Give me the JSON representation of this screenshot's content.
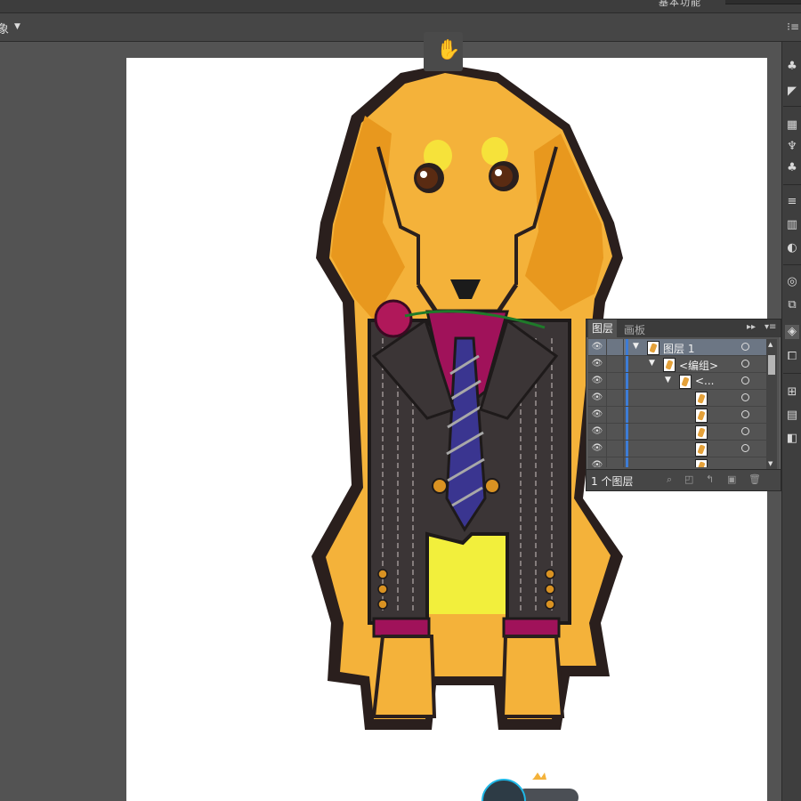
{
  "app": {
    "workspace_label": "基本功能",
    "control_bar_label": "象"
  },
  "colors": {
    "ui_dark": "#535353",
    "artboard": "#ffffff",
    "selection_bar": "#3d7cd6",
    "dog_fur": "#f4b23a",
    "suit": "#3b3536",
    "shirt": "#a0125a",
    "tie_stripe": "#3a3590"
  },
  "layers_panel": {
    "tabs": [
      "图层",
      "画板"
    ],
    "menu_icon": "panel-menu-icon",
    "rows": [
      {
        "name": "图层 1",
        "indent": 0,
        "expanded": true,
        "selected": true
      },
      {
        "name": "<编组>",
        "indent": 1,
        "expanded": true,
        "selected": false
      },
      {
        "name": "<...",
        "indent": 2,
        "expanded": true,
        "selected": false
      },
      {
        "name": "",
        "indent": 3,
        "expanded": false,
        "selected": false
      },
      {
        "name": "",
        "indent": 3,
        "expanded": false,
        "selected": false
      },
      {
        "name": "",
        "indent": 3,
        "expanded": false,
        "selected": false
      },
      {
        "name": "",
        "indent": 3,
        "expanded": false,
        "selected": false
      },
      {
        "name": "",
        "indent": 3,
        "expanded": false,
        "selected": false
      }
    ],
    "footer_count": "1 个图层"
  },
  "right_dock_icons": [
    "color-icon",
    "gradient-icon",
    "swatches-icon",
    "brushes-icon",
    "symbols-icon",
    "stroke-icon",
    "transparency-icon",
    "appearance-icon",
    "graphic-styles-icon",
    "layers-icon",
    "artboards-icon",
    "transform-icon",
    "align-icon",
    "pathfinder-icon"
  ],
  "artwork": {
    "subject": "golden retriever in pinstripe suit with rose"
  }
}
